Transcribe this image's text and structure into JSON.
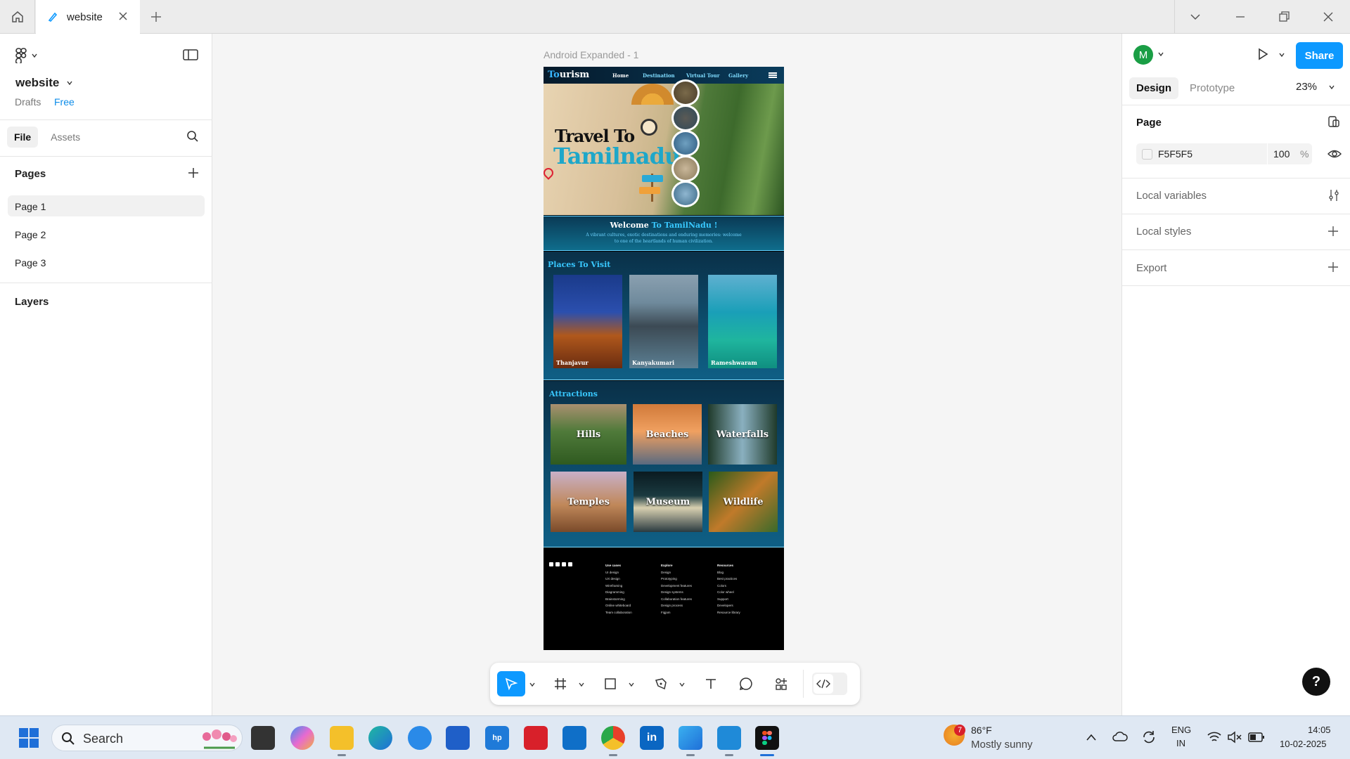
{
  "tab": {
    "title": "website"
  },
  "left_panel": {
    "file_name": "website",
    "drafts_label": "Drafts",
    "plan_label": "Free",
    "tabs": [
      "File",
      "Assets"
    ],
    "pages_heading": "Pages",
    "pages": [
      "Page 1",
      "Page 2",
      "Page 3"
    ],
    "layers_heading": "Layers"
  },
  "right_panel": {
    "avatar_letter": "M",
    "share_label": "Share",
    "tabs": [
      "Design",
      "Prototype"
    ],
    "zoom": "23%",
    "page_heading": "Page",
    "fill_hex": "F5F5F5",
    "fill_opacity": "100",
    "fill_unit": "%",
    "local_variables": "Local variables",
    "local_styles": "Local styles",
    "export": "Export",
    "help": "?"
  },
  "canvas": {
    "frame_label": "Android Expanded - 1",
    "design": {
      "brand_a": "To",
      "brand_b": "urism",
      "nav_links": [
        "Home",
        "Destination",
        "Virtual Tour",
        "Gallery"
      ],
      "hero_line1": "Travel To",
      "hero_line2": "Tamilnadu",
      "welcome_a": "Welcome",
      "welcome_b": "To TamilNadu !",
      "welcome_sub": "A vibrant cultures, exotic destinations and enduring memories: welcome to one of the heartlands of human civilization.",
      "places_a": "Places",
      "places_b": "To Visit",
      "places": [
        "Thanjavur",
        "Kanyakumari",
        "Rameshwaram"
      ],
      "attractions_a": "Att",
      "attractions_b": "ractions",
      "attractions": [
        "Hills",
        "Beaches",
        "Waterfalls",
        "Temples",
        "Museum",
        "Wildlife"
      ],
      "footer_cols": [
        {
          "heading": "Use cases",
          "items": [
            "UI design",
            "UX design",
            "Wireframing",
            "Diagramming",
            "Brainstorming",
            "Online whiteboard",
            "Team collaboration"
          ]
        },
        {
          "heading": "Explore",
          "items": [
            "Design",
            "Prototyping",
            "Development features",
            "Design systems",
            "Collaboration features",
            "Design process",
            "Figjam"
          ]
        },
        {
          "heading": "Resources",
          "items": [
            "Blog",
            "Best practices",
            "Colors",
            "Color wheel",
            "Support",
            "Developers",
            "Resource library"
          ]
        }
      ]
    }
  },
  "taskbar": {
    "search_label": "Search",
    "weather_badge": "7",
    "weather_temp": "86°F",
    "weather_desc": "Mostly sunny",
    "lang_1": "ENG",
    "lang_2": "IN",
    "time": "14:05",
    "date": "10-02-2025"
  }
}
